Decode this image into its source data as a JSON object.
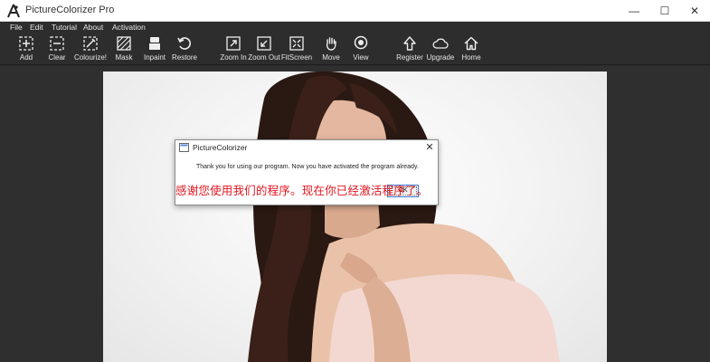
{
  "window": {
    "title": "PictureColorizer Pro",
    "controls": {
      "minimize": "—",
      "maximize": "☐",
      "close": "✕"
    }
  },
  "menu": {
    "items": [
      "File",
      "Edit",
      "Tutorial",
      "About",
      "Activation"
    ]
  },
  "toolbar": {
    "items": [
      {
        "label": "Add",
        "icon": "add-icon"
      },
      {
        "label": "Clear",
        "icon": "clear-icon"
      },
      {
        "label": "Colourize!",
        "icon": "colourize-icon"
      },
      {
        "label": "Mask",
        "icon": "mask-icon"
      },
      {
        "label": "Inpaint",
        "icon": "inpaint-icon"
      },
      {
        "label": "Restore",
        "icon": "restore-icon"
      },
      {
        "label": "Zoom In",
        "icon": "zoom-in-icon"
      },
      {
        "label": "Zoom Out",
        "icon": "zoom-out-icon"
      },
      {
        "label": "FitScreen",
        "icon": "fit-screen-icon"
      },
      {
        "label": "Move",
        "icon": "hand-icon"
      },
      {
        "label": "View",
        "icon": "view-icon"
      },
      {
        "label": "Register",
        "icon": "register-icon"
      },
      {
        "label": "Upgrade",
        "icon": "cloud-upgrade-icon"
      },
      {
        "label": "Home",
        "icon": "home-icon"
      }
    ]
  },
  "dialog": {
    "title": "PictureColorizer",
    "message": "Thank you for using our program. Now you have activated the program already.",
    "ok_label": "OK",
    "close_glyph": "✕"
  },
  "caption": {
    "text": "感谢您使用我们的程序。现在你已经激活程序了。",
    "color": "#e0141e"
  },
  "colors": {
    "menubar_bg": "#2d2d2d",
    "canvas_bg": "#2f2f2f",
    "dialog_accent": "#3a7bd5"
  }
}
